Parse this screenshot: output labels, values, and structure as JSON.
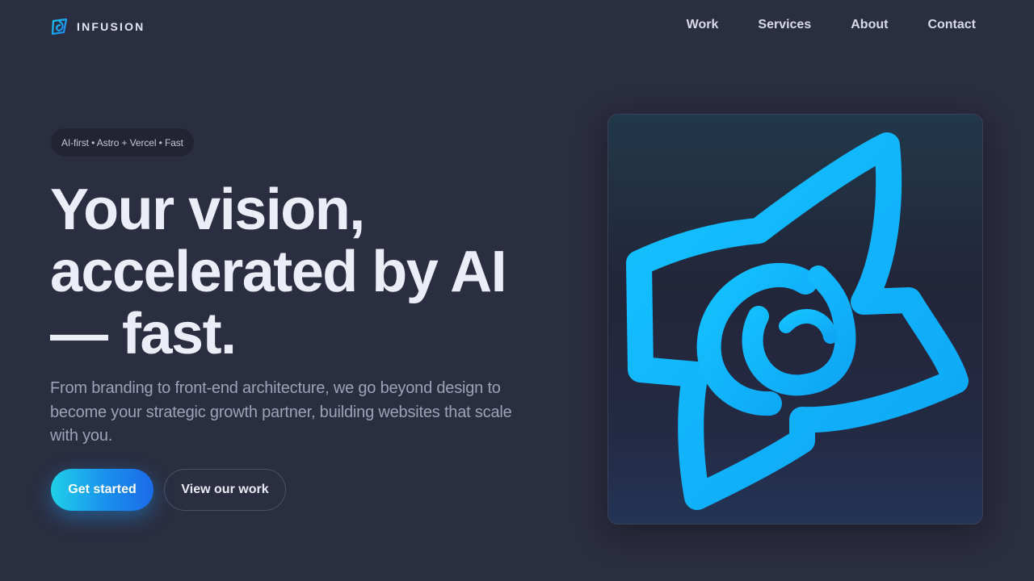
{
  "brand": {
    "name": "INFUSION",
    "icon": "infusion-logo-icon",
    "accent_color": "#12b4ff"
  },
  "nav": {
    "items": [
      {
        "label": "Work"
      },
      {
        "label": "Services"
      },
      {
        "label": "About"
      },
      {
        "label": "Contact"
      }
    ]
  },
  "hero": {
    "badge": "AI-first • Astro + Vercel • Fast",
    "headline": {
      "line1": "Your vision,",
      "line2": "accelerated by AI",
      "line3": "— fast."
    },
    "subcopy": "From branding to front-end architecture, we go beyond design to become your strategic growth partner, building websites that scale with you.",
    "primary_cta": "Get started",
    "secondary_cta": "View our work",
    "card_icon": "infusion-star-logo-icon"
  },
  "colors": {
    "background": "#2b2d40",
    "primary_gradient": [
      "#1fd0e8",
      "#1b6be8"
    ]
  }
}
